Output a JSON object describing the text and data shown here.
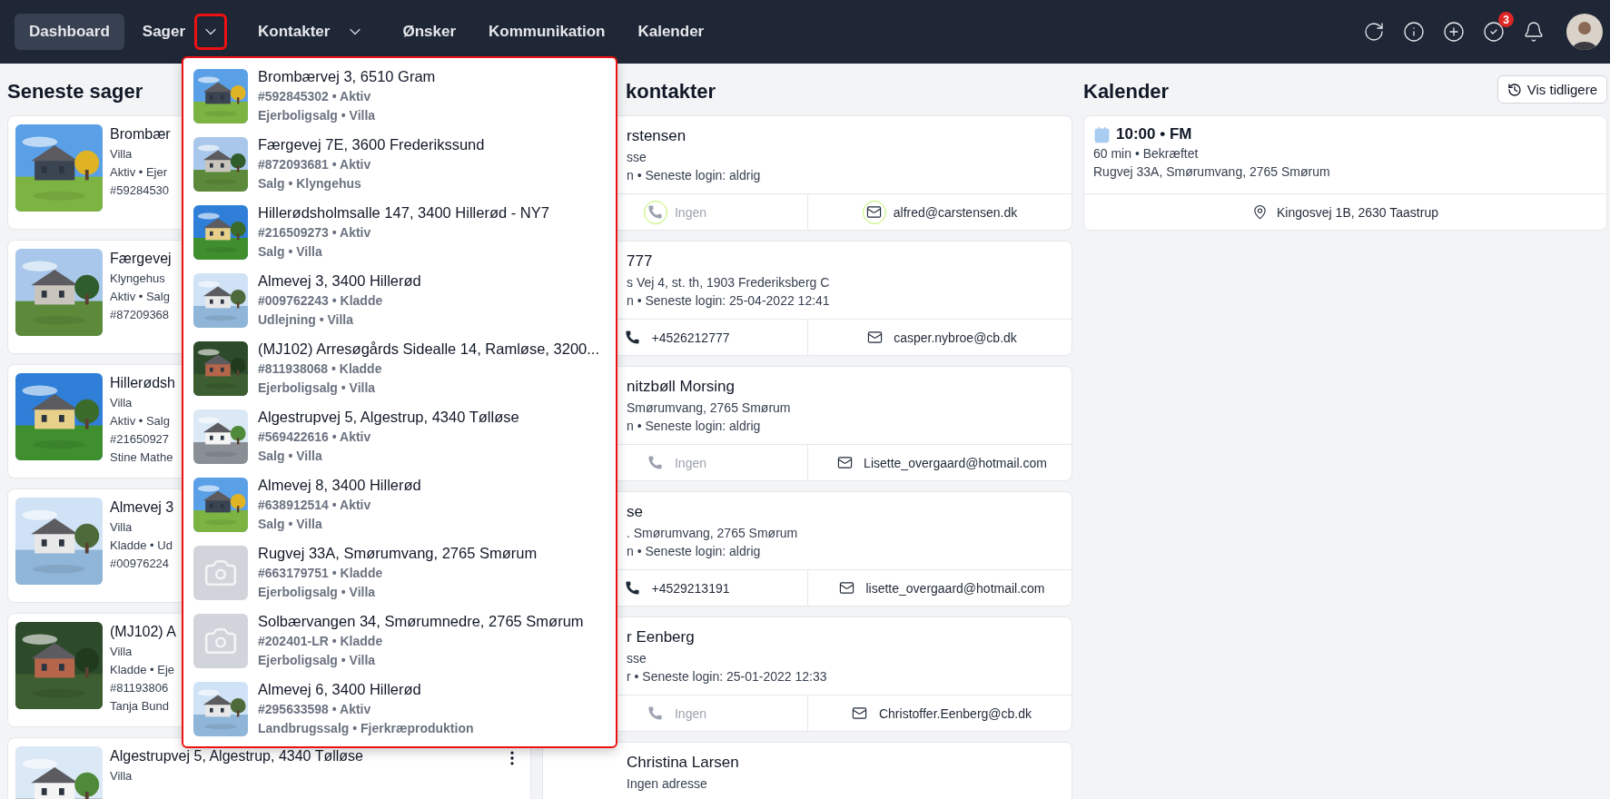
{
  "nav": {
    "items": [
      {
        "label": "Dashboard",
        "kind": "link",
        "selected": true,
        "open": false
      },
      {
        "label": "Sager",
        "kind": "menu",
        "selected": false,
        "open": true
      },
      {
        "label": "Kontakter",
        "kind": "menu",
        "selected": false,
        "open": false
      },
      {
        "label": "Ønsker",
        "kind": "link",
        "selected": false,
        "open": false
      },
      {
        "label": "Kommunikation",
        "kind": "link",
        "selected": false,
        "open": false
      },
      {
        "label": "Kalender",
        "kind": "link",
        "selected": false,
        "open": false
      }
    ],
    "tasks_badge": "3"
  },
  "cases": {
    "title": "Seneste sager",
    "items": [
      {
        "title": "Brombær",
        "lines": [
          "Villa",
          "Aktiv • Ejer",
          "#59284530"
        ],
        "actions": false
      },
      {
        "title": "Færgevej",
        "lines": [
          "Klyngehus",
          "Aktiv • Salg",
          "#87209368"
        ],
        "actions": false
      },
      {
        "title": "Hillerødsh",
        "lines": [
          "Villa",
          "Aktiv • Salg",
          "#21650927",
          "Stine Mathe"
        ],
        "actions": false
      },
      {
        "title": "Almevej 3",
        "lines": [
          "Villa",
          "Kladde • Ud",
          "#00976224"
        ],
        "actions": false
      },
      {
        "title": "(MJ102) A",
        "lines": [
          "Villa",
          "Kladde • Eje",
          "#81193806",
          "Tanja Bund"
        ],
        "actions": false
      },
      {
        "title": "Algestrupvej 5, Algestrup, 4340 Tølløse",
        "lines": [
          "Villa"
        ],
        "actions": true
      }
    ]
  },
  "contacts": {
    "title": "kontakter",
    "items": [
      {
        "name": "rstensen",
        "lines": [
          "sse",
          "n • Seneste login: aldrig"
        ],
        "phone": {
          "text": "Ingen",
          "missing": true,
          "ring": true
        },
        "email": {
          "text": "alfred@carstensen.dk",
          "ring": true
        }
      },
      {
        "name": "777",
        "lines": [
          "s Vej 4, st. th, 1903 Frederiksberg C",
          "n • Seneste login: 25-04-2022 12:41"
        ],
        "phone": {
          "text": "+4526212777",
          "missing": false,
          "ring": false
        },
        "email": {
          "text": "casper.nybroe@cb.dk",
          "ring": false
        }
      },
      {
        "name": "nitzbøll Morsing",
        "lines": [
          "Smørumvang, 2765 Smørum",
          "n • Seneste login: aldrig"
        ],
        "phone": {
          "text": "Ingen",
          "missing": true,
          "ring": false
        },
        "email": {
          "text": "Lisette_overgaard@hotmail.com",
          "ring": false
        }
      },
      {
        "name": "se",
        "lines": [
          ". Smørumvang, 2765 Smørum",
          "n • Seneste login: aldrig"
        ],
        "phone": {
          "text": "+4529213191",
          "missing": false,
          "ring": false
        },
        "email": {
          "text": "lisette_overgaard@hotmail.com",
          "ring": false
        }
      },
      {
        "name": "r Eenberg",
        "lines": [
          "sse",
          "r • Seneste login: 25-01-2022 12:33"
        ],
        "phone": {
          "text": "Ingen",
          "missing": true,
          "ring": false
        },
        "email": {
          "text": "Christoffer.Eenberg@cb.dk",
          "ring": false
        }
      },
      {
        "name": "Christina Larsen",
        "lines": [
          "Ingen adresse"
        ]
      }
    ]
  },
  "calendar": {
    "title": "Kalender",
    "button": "Vis tidligere",
    "events": [
      {
        "time": "10:00 • FM",
        "lines": [
          "60 min • Bekræftet",
          "Rugvej 33A, Smørumvang, 2765 Smørum"
        ],
        "location": "Kingosvej 1B, 2630 Taastrup"
      }
    ]
  },
  "dropdown": {
    "items": [
      {
        "title": "Brombærvej 3, 6510 Gram",
        "meta": "#592845302 • Aktiv",
        "category": "Ejerboligsalg • Villa"
      },
      {
        "title": "Færgevej 7E, 3600 Frederikssund",
        "meta": "#872093681 • Aktiv",
        "category": "Salg • Klyngehus"
      },
      {
        "title": "Hillerødsholmsalle 147, 3400 Hillerød - NY7",
        "meta": "#216509273 • Aktiv",
        "category": "Salg • Villa"
      },
      {
        "title": "Almevej 3, 3400 Hillerød",
        "meta": "#009762243 • Kladde",
        "category": "Udlejning • Villa"
      },
      {
        "title": "(MJ102) Arresøgårds Sidealle 14, Ramløse, 3200...",
        "meta": "#811938068 • Kladde",
        "category": "Ejerboligsalg • Villa"
      },
      {
        "title": "Algestrupvej 5, Algestrup, 4340 Tølløse",
        "meta": "#569422616 • Aktiv",
        "category": "Salg • Villa"
      },
      {
        "title": "Almevej 8, 3400 Hillerød",
        "meta": "#638912514 • Aktiv",
        "category": "Salg • Villa"
      },
      {
        "kind": "placeholder",
        "title": "Rugvej 33A, Smørumvang, 2765 Smørum",
        "meta": "#663179751 • Kladde",
        "category": "Ejerboligsalg • Villa"
      },
      {
        "kind": "placeholder",
        "title": "Solbærvangen 34, Smørumnedre, 2765 Smørum",
        "meta": "#202401-LR • Kladde",
        "category": "Ejerboligsalg • Villa"
      },
      {
        "title": "Almevej 6, 3400 Hillerød",
        "meta": "#295633598 • Aktiv",
        "category": "Landbrugssalg • Fjerkræproduktion"
      }
    ]
  }
}
